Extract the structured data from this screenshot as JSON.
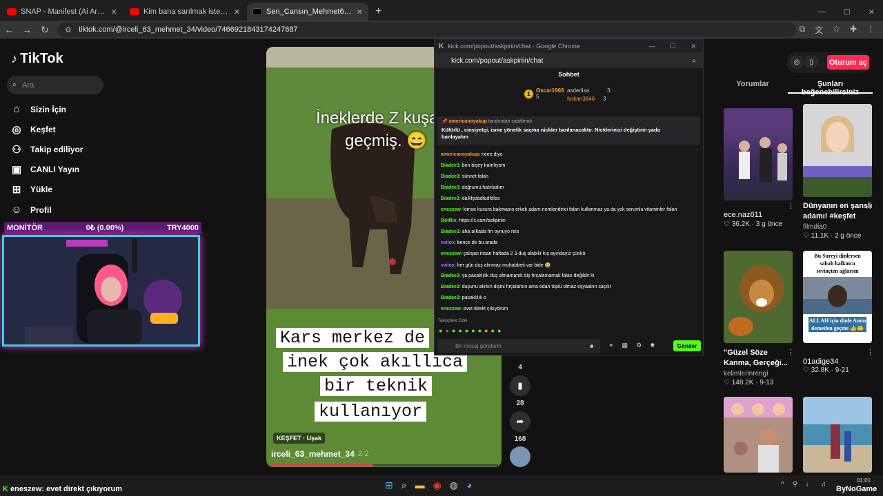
{
  "browser": {
    "tabs": [
      {
        "title": "SNAP - Manifest (Ai Arabesk Co",
        "color": "#ff0000",
        "active": false
      },
      {
        "title": "Kim bana sarılmak istedi ben o",
        "color": "#ff0000",
        "active": false
      },
      {
        "title": "Sen_Cansın_Mehmet63 (@ircel",
        "color": "#000000",
        "active": true
      }
    ],
    "url": "tiktok.com/@irceli_63_mehmet_34/video/7466921843174247687"
  },
  "tiktok": {
    "logo": "TikTok",
    "search_placeholder": "Ara",
    "nav": [
      {
        "label": "Sizin İçin",
        "icon": "home-icon"
      },
      {
        "label": "Keşfet",
        "icon": "compass-icon"
      },
      {
        "label": "Takip ediliyor",
        "icon": "following-icon"
      },
      {
        "label": "CANLI Yayın",
        "icon": "live-icon"
      },
      {
        "label": "Yükle",
        "icon": "upload-icon"
      },
      {
        "label": "Profil",
        "icon": "profile-icon"
      }
    ],
    "login_label": "Oturum aç",
    "right_tabs": [
      "Yorumlar",
      "Şunları beğenebilirsiniz"
    ]
  },
  "stream_overlay": {
    "monitor_label": "MONİTÖR",
    "monitor_value": "0₺ (0.00%)",
    "monitor_right": "TRY4000"
  },
  "video": {
    "caption_line1": "İneklerde Z kuşağ",
    "caption_line2": "geçmiş. 😄",
    "boxes": [
      "Kars merkez de",
      "inek çok akıllıca",
      "bir teknik",
      "kullanıyor"
    ],
    "tag": "KEŞFET · Uşak",
    "author": "irceli_63_mehmet_34",
    "date": "· 2-2",
    "progress": 0.45,
    "actions": [
      {
        "icon": "comment-icon",
        "count": "4"
      },
      {
        "icon": "bookmark-icon",
        "count": "28"
      },
      {
        "icon": "share-icon",
        "count": "168"
      }
    ]
  },
  "chat_popup": {
    "window_title": "kick.com/popout/askpiriin/chat - Google Chrome",
    "address": "kick.com/popout/askpiriin/chat",
    "header": "Sohbet",
    "gifters": [
      {
        "rank": "1",
        "name": "Oscar1903",
        "count": "5"
      },
      {
        "name": "asderlisa",
        "count": "3"
      },
      {
        "name": "furkan3846",
        "count": "3"
      }
    ],
    "pinned_by": "americanoyakup",
    "pinned_suffix": "tarafından sabitlendi",
    "pinned_text": "Küfürlü , cinsiyetçi, isme yönelik saçma nickler banlanacaktır. Nicklerinizi değiştirin yada banlayalım",
    "messages": [
      {
        "user": "americanoyakup",
        "text": ": neee diyo",
        "style": "u2"
      },
      {
        "user": "Biadee3",
        "text": ": ben bişey hatırlıyom",
        "style": "u"
      },
      {
        "user": "Biadee3",
        "text": ": sünnet falan",
        "style": "u"
      },
      {
        "user": "Biadee3",
        "text": ": doğrumu hatırladım",
        "style": "u"
      },
      {
        "user": "Biadee3",
        "text": ": dalkfşdadfadfdfas",
        "style": "u"
      },
      {
        "user": "eneszew",
        "text": ": kimse kusura bakmasın erkek adam nemlendirici falan kullanmaz ya da yok serumlu vitaminler falan",
        "style": "u"
      },
      {
        "user": "BotRix",
        "text": ": https://x.com/askpiriin",
        "style": "u"
      },
      {
        "user": "Biadee3",
        "text": ": aha arkada fm oynuyo reis",
        "style": "u"
      },
      {
        "user": "vviiox",
        "text": ": bence de bu arada",
        "style": "u3"
      },
      {
        "user": "eneszew",
        "text": ": çalışan insan haftada 2 3 duş alabilir kış ayındayız çünkü",
        "style": "u"
      },
      {
        "user": "vviiox",
        "text": ": her gün duş alınmaz muhabbeti var bide 🤮",
        "style": "u3"
      },
      {
        "user": "Biadee3",
        "text": ": ya pasaklılık duş almamamk diş fırçalamamak falan değildir ki",
        "style": "u"
      },
      {
        "user": "Biadee3",
        "text": ": duşunu alırsın dişini fırçalarsın ama odan toplu olmaz eşyaalrın saçılır",
        "style": "u"
      },
      {
        "user": "Biadee3",
        "text": ": pasaklılık o",
        "style": "u"
      },
      {
        "user": "eneszew",
        "text": ": evet direkt çıkıyorum",
        "style": "u"
      }
    ],
    "followers_label": "Takipçilere Özel",
    "input_placeholder": "Bir mesaj gönderin",
    "send_label": "Gönder"
  },
  "recommendations": [
    {
      "title": "",
      "user": "ece.naz611",
      "likes": "36.2K",
      "age": "3 g önce"
    },
    {
      "title": "Dünyanın en şanslı adamı! #keşfet",
      "user": "filmdia0",
      "likes": "11.1K",
      "age": "2 g önce"
    },
    {
      "title": "\"Güzel Söze Kanma, Gerçeği...",
      "user": "kelimlerinrengi",
      "likes": "148.2K",
      "age": "9-13"
    },
    {
      "title": "",
      "user": "01adige34",
      "likes": "32.8K",
      "age": "9-21"
    }
  ],
  "thumb_texts": {
    "t4_top": "Bu Sureyi dinlersen sabah kalkınca sevinçten ağlarsın",
    "t4_bottom": "ALLAH için dinle Amin demeden geçme 👍🤲"
  },
  "taskbar": {
    "notice_user": "eneszew",
    "notice_text": ": evet direkt çıkıyorum",
    "time": "01:01",
    "watermark": "ByNoGame"
  }
}
